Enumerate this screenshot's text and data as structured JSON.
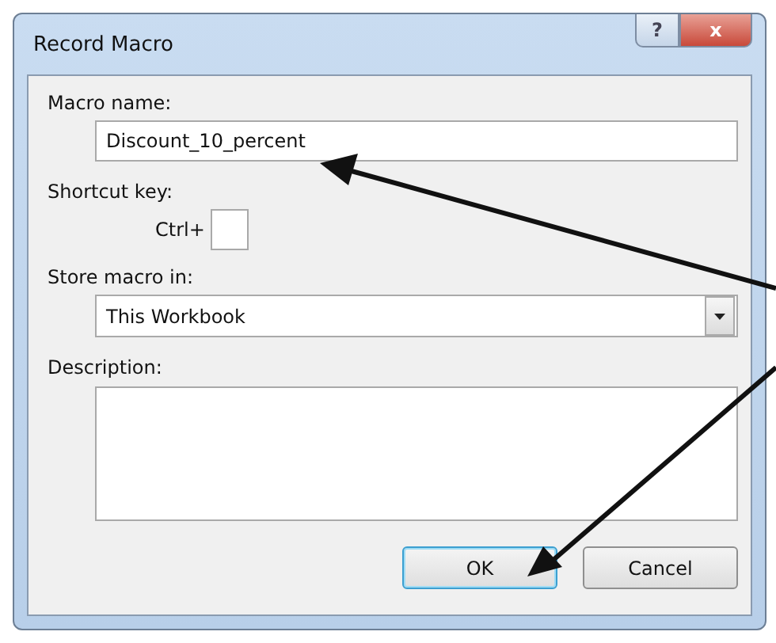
{
  "window": {
    "title": "Record Macro",
    "buttons": [
      "?",
      "x"
    ]
  },
  "macro_name": {
    "label": "Macro name:",
    "value": "Discount_10_percent"
  },
  "shortcut_key": {
    "label": "Shortcut key:",
    "prefix": "Ctrl+"
  },
  "store_macro_in": {
    "label": "Store macro in:",
    "value": "This Workbook"
  },
  "description": {
    "label": "Description:"
  },
  "buttons": [
    {
      "label": "OK",
      "default": true
    },
    {
      "label": "Cancel",
      "default": false
    }
  ]
}
